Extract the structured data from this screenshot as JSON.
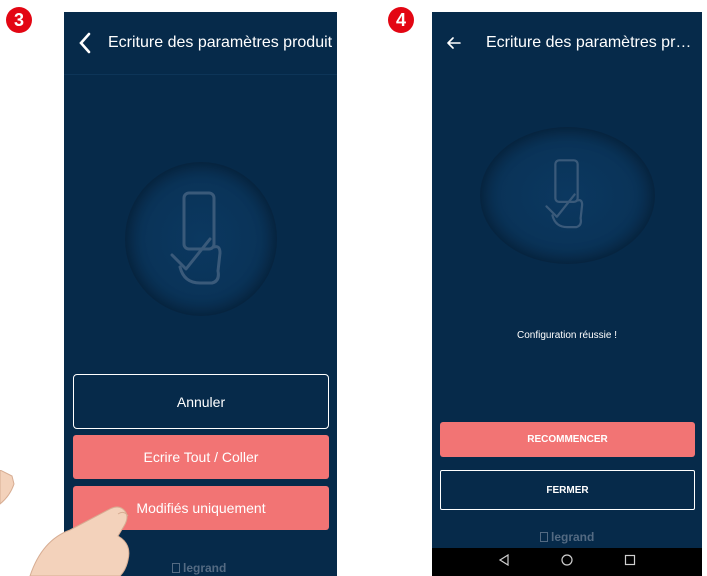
{
  "steps": {
    "left": "3",
    "right": "4"
  },
  "left_screen": {
    "title": "Ecriture des paramètres produit",
    "buttons": {
      "cancel": "Annuler",
      "write_all": "Ecrire Tout / Coller",
      "modified_only": "Modifiés uniquement"
    },
    "brand": "legrand"
  },
  "right_screen": {
    "title": "Ecriture des paramètres prod...",
    "status": "Configuration réussie !",
    "buttons": {
      "restart": "RECOMMENCER",
      "close": "FERMER"
    },
    "brand": "legrand"
  },
  "colors": {
    "background": "#062a4a",
    "accent": "#f27474",
    "badge": "#e30613"
  },
  "icons": [
    "chevron-left-icon",
    "arrow-left-icon",
    "nfc-phone-hand-icon",
    "legrand-logo-icon",
    "nav-back-icon",
    "nav-home-icon",
    "nav-recent-icon"
  ]
}
